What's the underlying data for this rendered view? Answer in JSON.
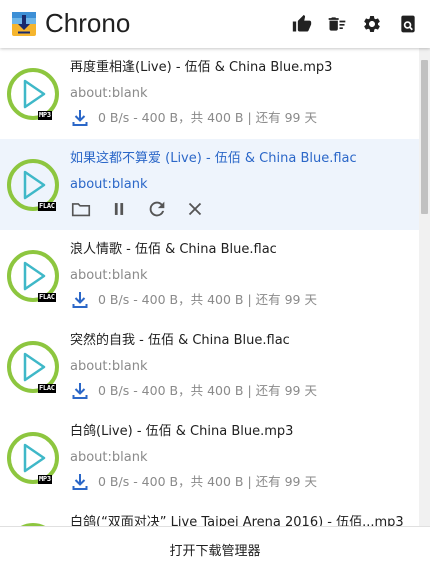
{
  "app": {
    "title": "Chrono"
  },
  "header": {
    "icons": [
      "thumbs-up-icon",
      "trash-icon",
      "settings-icon",
      "search-icon"
    ]
  },
  "colors": {
    "accent": "#2b67c8",
    "progress_ring": "#8dc63f",
    "play_icon": "#3fb8c8",
    "active_bg": "#eef4fc"
  },
  "downloads": [
    {
      "filename": "再度重相逢(Live) - 伍佰 & China Blue.mp3",
      "url": "about:blank",
      "type": "MP3",
      "status": "0 B/s - 400 B，共 400 B | 还有 99 天",
      "active": false
    },
    {
      "filename": "如果这都不算爱 (Live) - 伍佰 & China Blue.flac",
      "url": "about:blank",
      "type": "FLAC",
      "status": "",
      "active": true
    },
    {
      "filename": "浪人情歌 - 伍佰 & China Blue.flac",
      "url": "about:blank",
      "type": "FLAC",
      "status": "0 B/s - 400 B，共 400 B | 还有 99 天",
      "active": false
    },
    {
      "filename": "突然的自我 - 伍佰 & China Blue.flac",
      "url": "about:blank",
      "type": "FLAC",
      "status": "0 B/s - 400 B，共 400 B | 还有 99 天",
      "active": false
    },
    {
      "filename": "白鸽(Live) - 伍佰 & China Blue.mp3",
      "url": "about:blank",
      "type": "MP3",
      "status": "0 B/s - 400 B，共 400 B | 还有 99 天",
      "active": false
    },
    {
      "filename": "白鸽(“双面对决” Live Taipei Arena 2016) - 伍佰...mp3",
      "url": "",
      "type": "",
      "status": "",
      "active": false
    }
  ],
  "footer": {
    "label": "打开下载管理器"
  }
}
